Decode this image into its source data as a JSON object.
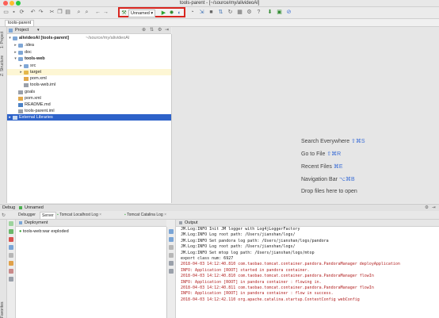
{
  "window": {
    "title": "tools-parent - [~/source/my/alivideoAl]"
  },
  "toolbar": {
    "run_config": "Unnamed",
    "icons": [
      "open-icon",
      "save-icon",
      "sync-icon",
      "back-icon",
      "forward-icon",
      "cut-icon",
      "copy-icon",
      "paste-icon",
      "find-icon",
      "replace-icon",
      "undo-icon",
      "redo-icon",
      "build-icon",
      "run-icon",
      "debug-icon",
      "coverage-icon",
      "stop-icon",
      "vcs-icon",
      "help-icon",
      "sdk-icon"
    ]
  },
  "navbar": {
    "breadcrumb": "tools-parent"
  },
  "left_stripe": {
    "project": "1: Project",
    "structure": "Z: Structure"
  },
  "project": {
    "title": "Project",
    "tree": [
      {
        "label": "alivideoAI [tools-parent]",
        "detail": "~/source/my/alivideoAI"
      },
      {
        "label": ".idea"
      },
      {
        "label": "doc"
      },
      {
        "label": "tools-web"
      },
      {
        "label": "src"
      },
      {
        "label": "target"
      },
      {
        "label": "pom.xml"
      },
      {
        "label": "tools-web.iml"
      },
      {
        "label": "goals"
      },
      {
        "label": "pom.xml"
      },
      {
        "label": "README.md"
      },
      {
        "label": "tools-parent.iml"
      },
      {
        "label": "External Libraries"
      }
    ]
  },
  "editor_hints": [
    {
      "label": "Search Everywhere",
      "key": "⇧⌘S"
    },
    {
      "label": "Go to File",
      "key": "⇧⌘R"
    },
    {
      "label": "Recent Files",
      "key": "⌘E"
    },
    {
      "label": "Navigation Bar",
      "key": "⌥⌘B"
    },
    {
      "label": "Drop files here to open",
      "key": ""
    }
  ],
  "debug": {
    "label": "Debug",
    "config": "Unnamed",
    "tabs": [
      "Debugger",
      "Server",
      "Tomcat Localhost Log",
      "Tomcat Catalina Log"
    ],
    "deployment_header": "Deployment",
    "output_header": "Output",
    "deployment_item": "tools-web:war exploded",
    "output_lines": [
      "JM.Log:INFO Init JM logger with Log4jLoggerFactory",
      "JM.Log:INFO Log root path: /Users/jianshan/logs/",
      "JM.Log:INFO Set pandora log path: /Users/jianshan/logs/pandora",
      "JM.Log:INFO Log root path: /Users/jianshan/logs/",
      "JM.Log:INFO Set mtop log path: /Users/jianshan/logs/mtop",
      "export class num: 6927",
      "2018-04-03 14:12:40.810 com.taobao.tomcat.container.pandora.PandoraManager deployApplication",
      "INFO: Application [ROOT] started in pandora container.",
      "2018-04-03 14:12:40.810 com.taobao.tomcat.container.pandora.PandoraManager flowIn",
      "INFO: Application [ROOT] in pandora container : flowing in.",
      "2018-04-03 14:12:40.811 com.taobao.tomcat.container.pandora.PandoraManager flowIn",
      "INFO: Application [ROOT] in pandora container : flow in success.",
      "2018-04-03 14:12:42.110 org.apache.catalina.startup.ContextConfig webConfig"
    ],
    "output_colors": [
      "black",
      "black",
      "black",
      "black",
      "black",
      "black",
      "red",
      "red",
      "red",
      "red",
      "red",
      "red",
      "red"
    ],
    "left_labels": [
      "Favorites",
      "Structure"
    ]
  },
  "colors": {
    "highlight_border": "#d8261f",
    "selection": "#2d62c9",
    "hint_key": "#3c6ed6"
  }
}
